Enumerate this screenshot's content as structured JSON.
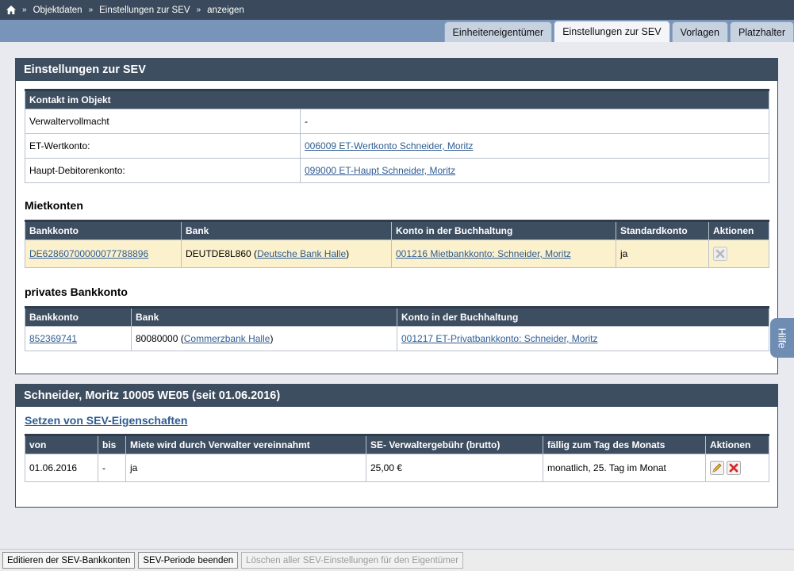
{
  "breadcrumb": {
    "items": [
      "Objektdaten",
      "Einstellungen zur SEV",
      "anzeigen"
    ],
    "separator": "»"
  },
  "tabs": [
    {
      "label": "Einheiteneigentümer",
      "active": false
    },
    {
      "label": "Einstellungen zur SEV",
      "active": true
    },
    {
      "label": "Vorlagen",
      "active": false
    },
    {
      "label": "Platzhalter",
      "active": false
    }
  ],
  "settings_panel": {
    "title": "Einstellungen zur SEV",
    "contact": {
      "header": "Kontakt im Objekt",
      "rows": [
        {
          "label": "Verwaltervollmacht",
          "value": "-"
        },
        {
          "label": "ET-Wertkonto:",
          "value": "006009 ET-Wertkonto Schneider, Moritz"
        },
        {
          "label": "Haupt-Debitorenkonto:",
          "value": "099000 ET-Haupt Schneider, Moritz"
        }
      ]
    },
    "mietkonten": {
      "title": "Mietkonten",
      "columns": [
        "Bankkonto",
        "Bank",
        "Konto in der Buchhaltung",
        "Standardkonto",
        "Aktionen"
      ],
      "row": {
        "iban": "DE62860700000077788896",
        "bic": "DEUTDE8L860",
        "bank_name": "Deutsche Bank Halle",
        "konto": "001216 Mietbankkonto: Schneider, Moritz",
        "standard": "ja"
      }
    },
    "privat": {
      "title": "privates Bankkonto",
      "columns": [
        "Bankkonto",
        "Bank",
        "Konto in der Buchhaltung"
      ],
      "row": {
        "account": "852369741",
        "blz": "80080000",
        "bank_name": "Commerzbank Halle",
        "konto": "001217 ET-Privatbankkonto: Schneider, Moritz"
      }
    }
  },
  "owner_panel": {
    "title": "Schneider, Moritz 10005 WE05 (seit 01.06.2016)",
    "link": "Setzen von SEV-Eigenschaften",
    "columns": [
      "von",
      "bis",
      "Miete wird durch Verwalter vereinnahmt",
      "SE- Verwaltergebühr (brutto)",
      "fällig zum Tag des Monats",
      "Aktionen"
    ],
    "row": {
      "von": "01.06.2016",
      "bis": "-",
      "miete": "ja",
      "gebuehr": "25,00 €",
      "faellig": "monatlich, 25. Tag im Monat"
    }
  },
  "help": {
    "label": "Hilfe"
  },
  "buttons": {
    "edit_accounts": "Editieren der SEV-Bankkonten",
    "end_period": "SEV-Periode beenden",
    "delete_all": "Löschen aller SEV-Einstellungen für den Eigentümer"
  },
  "colors": {
    "header_dark": "#3e4e61",
    "tab_bar": "#7894b8",
    "highlight_row": "#fcf1cd",
    "link": "#2f5c92"
  }
}
